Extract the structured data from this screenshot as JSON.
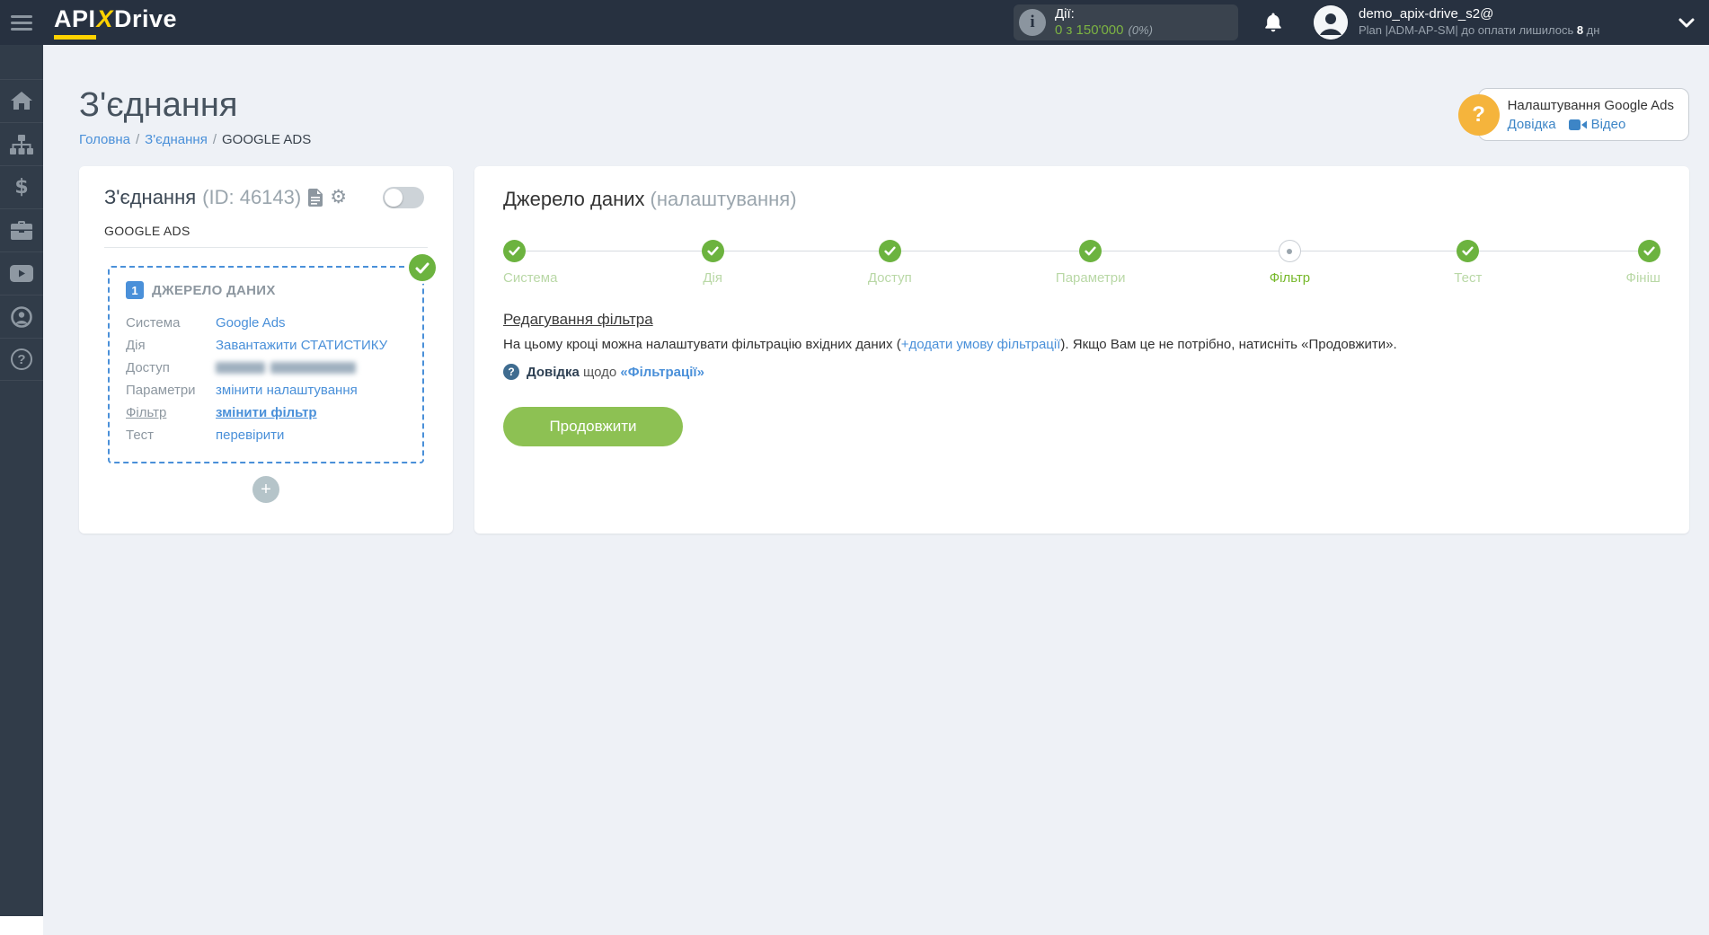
{
  "colors": {
    "brand_yellow": "#ffd200",
    "accent_green": "#6cb33f",
    "button_green": "#8dc153",
    "link_blue": "#4a90d9",
    "header_bg": "#273140",
    "sidebar_bg": "#313c49",
    "page_bg": "#eef1f6"
  },
  "header": {
    "logo": {
      "api": "API",
      "x": "X",
      "drive": "Drive"
    },
    "usage": {
      "label": "Дії:",
      "value": "0 з 150'000",
      "percent": "(0%)"
    },
    "user": {
      "name": "demo_apix-drive_s2@",
      "plan_prefix": "Plan |ADM-AP-SM| до оплати лишилось ",
      "plan_days": "8",
      "plan_suffix": " дн"
    }
  },
  "sidebar": {
    "items": [
      {
        "icon": "home"
      },
      {
        "icon": "connections"
      },
      {
        "icon": "billing"
      },
      {
        "icon": "services"
      },
      {
        "icon": "video"
      },
      {
        "icon": "profile"
      },
      {
        "icon": "help"
      }
    ]
  },
  "page": {
    "title": "З'єднання",
    "breadcrumb_separator": "/",
    "breadcrumb": [
      {
        "label": "Головна"
      },
      {
        "label": "З'єднання"
      },
      {
        "label": "GOOGLE ADS"
      }
    ]
  },
  "help_box": {
    "title": "Налаштування Google Ads",
    "help_link": "Довідка",
    "video_link": "Відео"
  },
  "connection_card": {
    "title": "З'єднання",
    "id_text": "(ID: 46143)",
    "service_label": "GOOGLE ADS",
    "source_block": {
      "badge": "1",
      "title": "ДЖЕРЕЛО ДАНИХ",
      "rows": [
        {
          "label": "Система",
          "value": "Google Ads"
        },
        {
          "label": "Дія",
          "value": "Завантажити СТАТИСТИКУ"
        },
        {
          "label": "Доступ",
          "value": "",
          "redacted": true
        },
        {
          "label": "Параметри",
          "value": "змінити налаштування"
        },
        {
          "label": "Фільтр",
          "value": "змінити фільтр",
          "emphasis": true
        },
        {
          "label": "Тест",
          "value": "перевірити"
        }
      ]
    }
  },
  "settings_panel": {
    "title": "Джерело даних",
    "subtitle": "(налаштування)",
    "steps": [
      {
        "label": "Система",
        "state": "done"
      },
      {
        "label": "Дія",
        "state": "done"
      },
      {
        "label": "Доступ",
        "state": "done"
      },
      {
        "label": "Параметри",
        "state": "done"
      },
      {
        "label": "Фільтр",
        "state": "current"
      },
      {
        "label": "Тест",
        "state": "done"
      },
      {
        "label": "Фініш",
        "state": "done"
      }
    ],
    "section_title": "Редагування фільтра",
    "description": {
      "before_link": "На цьому кроці можна налаштувати фільтрацію вхідних даних (",
      "link": "+додати умову фільтрації",
      "after_link": "). Якщо Вам це не потрібно, натисніть «Продовжити»."
    },
    "help_line": {
      "word1": "Довідка",
      "word2": " щодо ",
      "word3": "«Фільтрації»"
    },
    "continue_button": "Продовжити"
  }
}
